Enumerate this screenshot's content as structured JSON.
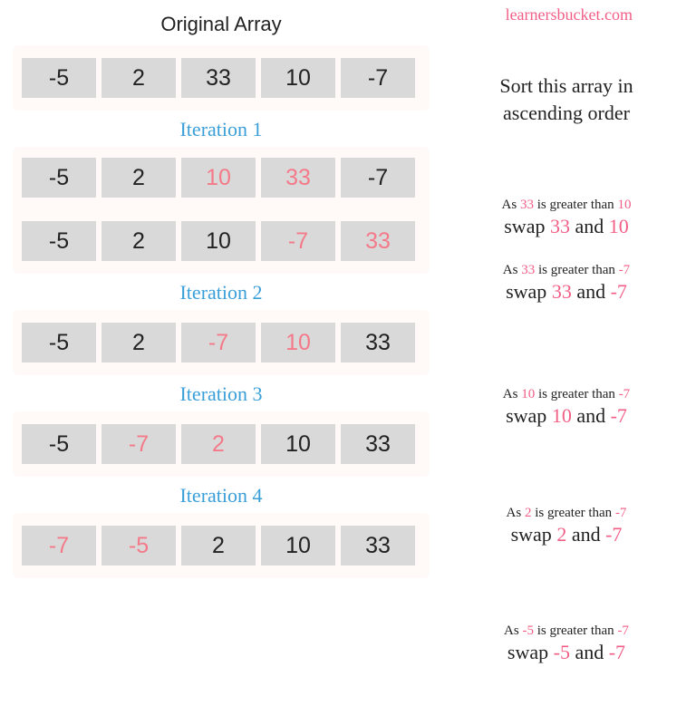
{
  "brand": "learnersbucket.com",
  "heading": "Original Array",
  "iterLabels": [
    "Iteration 1",
    "Iteration 2",
    "Iteration 3",
    "Iteration 4"
  ],
  "rows": {
    "orig": [
      {
        "v": "-5"
      },
      {
        "v": "2"
      },
      {
        "v": "33"
      },
      {
        "v": "10"
      },
      {
        "v": "-7"
      }
    ],
    "it1a": [
      {
        "v": "-5"
      },
      {
        "v": "2"
      },
      {
        "v": "10",
        "hl": true
      },
      {
        "v": "33",
        "hl": true
      },
      {
        "v": "-7"
      }
    ],
    "it1b": [
      {
        "v": "-5"
      },
      {
        "v": "2"
      },
      {
        "v": "10"
      },
      {
        "v": "-7",
        "hl": true
      },
      {
        "v": "33",
        "hl": true
      }
    ],
    "it2": [
      {
        "v": "-5"
      },
      {
        "v": "2"
      },
      {
        "v": "-7",
        "hl": true
      },
      {
        "v": "10",
        "hl": true
      },
      {
        "v": "33"
      }
    ],
    "it3": [
      {
        "v": "-5"
      },
      {
        "v": "-7",
        "hl": true
      },
      {
        "v": "2",
        "hl": true
      },
      {
        "v": "10"
      },
      {
        "v": "33"
      }
    ],
    "it4": [
      {
        "v": "-7",
        "hl": true
      },
      {
        "v": "-5",
        "hl": true
      },
      {
        "v": "2"
      },
      {
        "v": "10"
      },
      {
        "v": "33"
      }
    ]
  },
  "expl": {
    "top": {
      "line1": "Sort this array in",
      "line2": "ascending order"
    },
    "it1a": {
      "as": "As ",
      "a": "33",
      "mid": " is greater than ",
      "b": "10",
      "swap": "swap ",
      "s1": "33",
      "and": " and ",
      "s2": "10"
    },
    "it1b": {
      "as": "As ",
      "a": "33",
      "mid": " is greater than ",
      "b": "-7",
      "swap": "swap ",
      "s1": "33",
      "and": " and ",
      "s2": "-7"
    },
    "it2": {
      "as": "As ",
      "a": "10",
      "mid": " is greater than ",
      "b": "-7",
      "swap": "swap ",
      "s1": "10",
      "and": " and ",
      "s2": "-7"
    },
    "it3": {
      "as": "As ",
      "a": "2",
      "mid": " is greater than ",
      "b": "-7",
      "swap": "swap ",
      "s1": "2",
      "and": " and ",
      "s2": "-7"
    },
    "it4": {
      "as": "As ",
      "a": "-5",
      "mid": " is greater than ",
      "b": "-7",
      "swap": "swap ",
      "s1": "-5",
      "and": " and ",
      "s2": "-7"
    }
  }
}
